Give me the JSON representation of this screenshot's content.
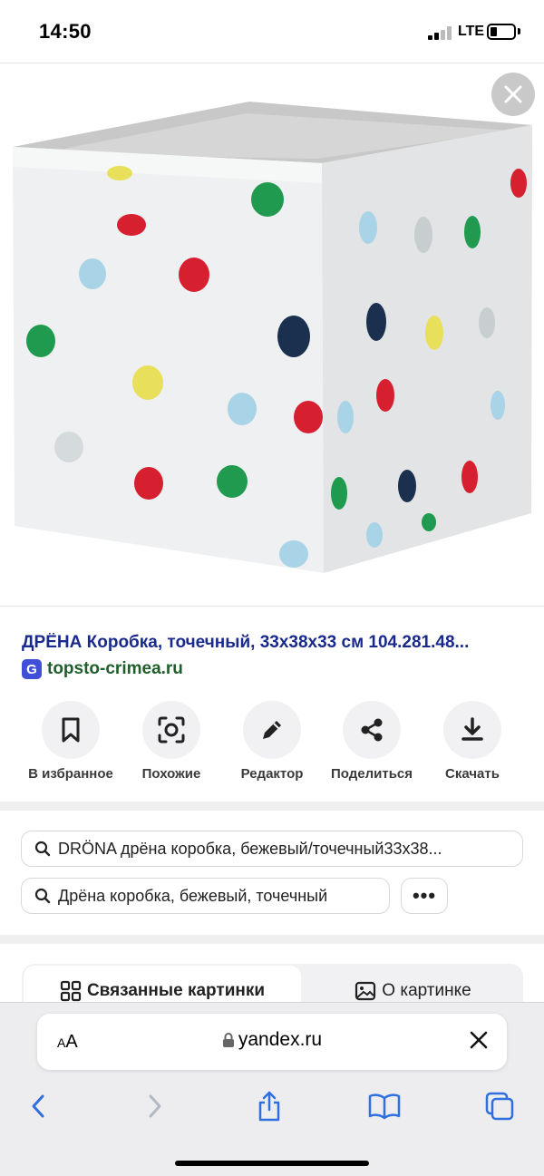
{
  "status_bar": {
    "time": "14:50",
    "network": "LTE"
  },
  "image_viewer": {
    "icon": "close-icon"
  },
  "result": {
    "title": "ДРЁНА Коробка, точечный, 33x38x33 см 104.281.48...",
    "source": "topsto-crimea.ru"
  },
  "actions": [
    {
      "label": "В избранное",
      "icon": "bookmark-icon"
    },
    {
      "label": "Похожие",
      "icon": "lens-search-icon"
    },
    {
      "label": "Редактор",
      "icon": "pencil-icon"
    },
    {
      "label": "Поделиться",
      "icon": "share-icon"
    },
    {
      "label": "Скачать",
      "icon": "download-icon"
    }
  ],
  "search_suggestions": [
    "DRÖNA дрёна коробка, бежевый/точечный33x38...",
    "Дрёна коробка, бежевый, точечный"
  ],
  "more_label": "•••",
  "tabs": [
    {
      "label": "Связанные картинки",
      "icon": "grid-icon",
      "active": true
    },
    {
      "label": "О картинке",
      "icon": "image-icon",
      "active": false
    }
  ],
  "browser": {
    "aa_label_small": "A",
    "aa_label_big": "A",
    "url": "yandex.ru"
  },
  "colors": {
    "title_blue": "#1a2a8c",
    "source_green": "#1e5e2a",
    "dot_red": "#d6202f",
    "dot_green": "#1f9a4f",
    "dot_navy": "#1b2f4f",
    "dot_yellow": "#e8df5a",
    "dot_lightblue": "#a9d3e6"
  }
}
